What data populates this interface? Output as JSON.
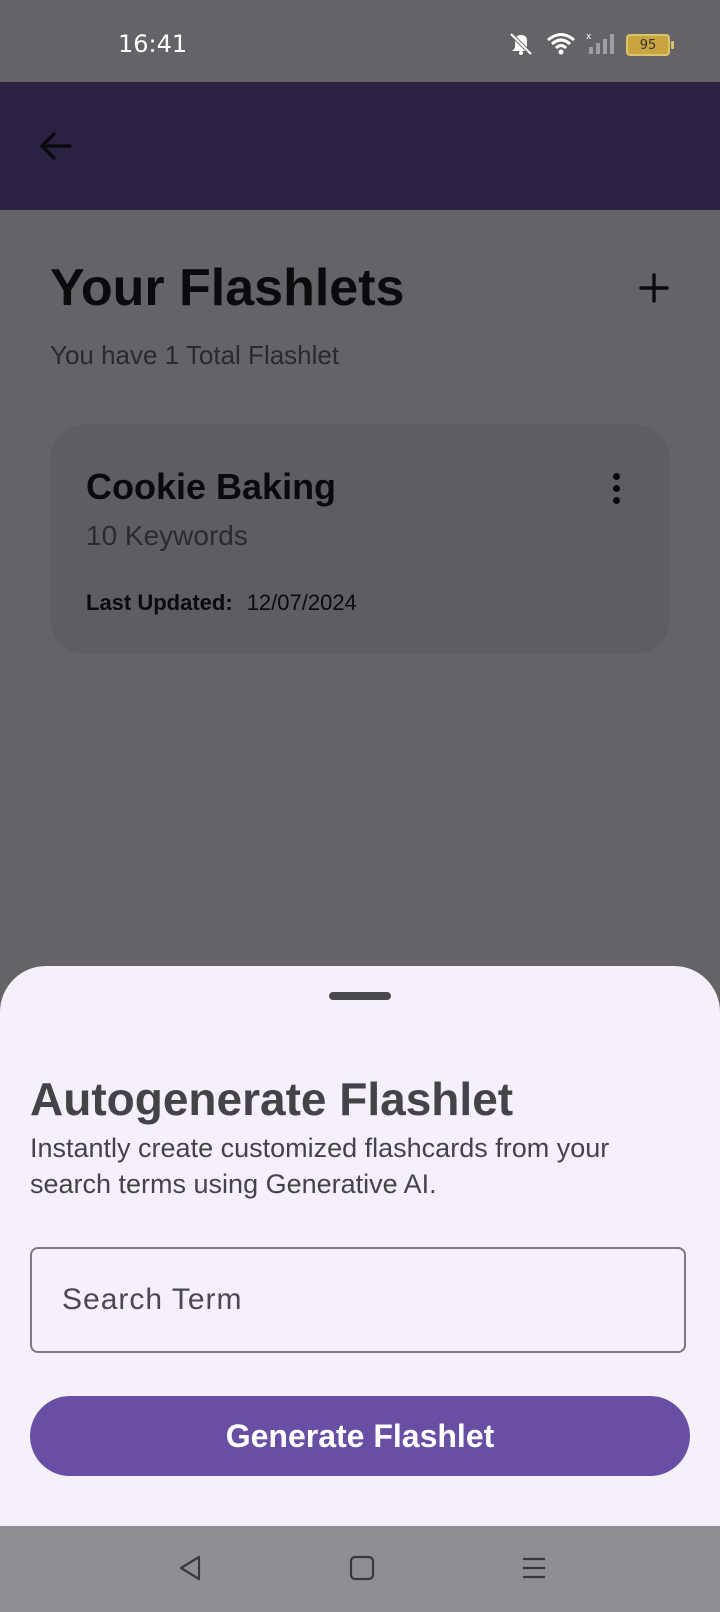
{
  "status_bar": {
    "time": "16:41",
    "battery_level": "95",
    "icons": [
      "mute-icon",
      "wifi-icon",
      "signal-icon",
      "battery-icon"
    ]
  },
  "app_bar": {
    "back_icon": "arrow-left-icon",
    "color": "#2b2243"
  },
  "main": {
    "title": "Your Flashlets",
    "subtitle": "You have 1 Total Flashlet",
    "add_icon": "plus-icon",
    "flashlets": [
      {
        "title": "Cookie Baking",
        "keywords": "10 Keywords",
        "last_updated_label": "Last Updated:",
        "last_updated_value": "12/07/2024",
        "menu_icon": "more-vertical-icon"
      }
    ]
  },
  "sheet": {
    "title": "Autogenerate Flashlet",
    "description": "Instantly create customized flashcards from your search terms using Generative AI.",
    "search_placeholder": "Search Term",
    "search_value": "",
    "button_label": "Generate Flashlet",
    "accent": "#684fa3"
  },
  "nav_bar": {
    "items": [
      "back-triangle-icon",
      "home-square-icon",
      "menu-lines-icon"
    ]
  }
}
